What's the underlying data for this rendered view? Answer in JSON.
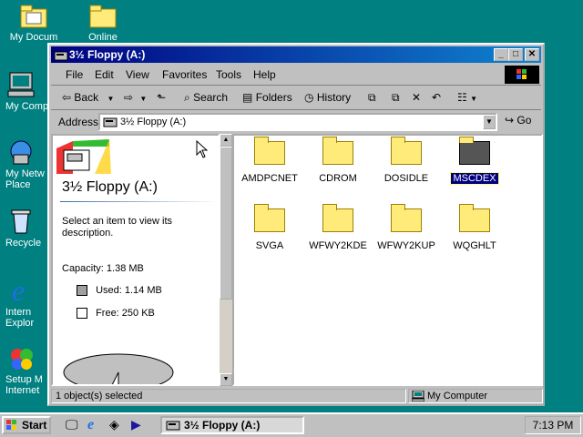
{
  "desktop": {
    "icons": [
      {
        "label": "My Docum"
      },
      {
        "label": "Online"
      },
      {
        "label": "My Comp"
      },
      {
        "label": "My Netw\nPlace"
      },
      {
        "label": "Recycle"
      },
      {
        "label": "Intern\nExplor"
      },
      {
        "label": "Setup M\nInternet"
      }
    ]
  },
  "window": {
    "title": "3½ Floppy (A:)",
    "menu": [
      "File",
      "Edit",
      "View",
      "Favorites",
      "Tools",
      "Help"
    ],
    "toolbar": {
      "back": "Back",
      "search": "Search",
      "folders": "Folders",
      "history": "History"
    },
    "address": {
      "label": "Address",
      "value": "3½ Floppy (A:)",
      "go": "Go"
    },
    "left_pane": {
      "heading": "3½ Floppy (A:)",
      "description": "Select an item to view its description.",
      "capacity": "Capacity: 1.38 MB",
      "used": "Used: 1.14 MB",
      "free": "Free: 250 KB",
      "used_fraction": 0.82
    },
    "files": [
      {
        "name": "AMDPCNET"
      },
      {
        "name": "CDROM"
      },
      {
        "name": "DOSIDLE"
      },
      {
        "name": "MSCDEX"
      },
      {
        "name": "SVGA"
      },
      {
        "name": "WFWY2KDE"
      },
      {
        "name": "WFWY2KUP"
      },
      {
        "name": "WQGHLT"
      }
    ],
    "status": {
      "selected": "1 object(s) selected",
      "zone": "My Computer"
    }
  },
  "taskbar": {
    "start": "Start",
    "task": "3½ Floppy (A:)",
    "clock": "7:13 PM"
  }
}
